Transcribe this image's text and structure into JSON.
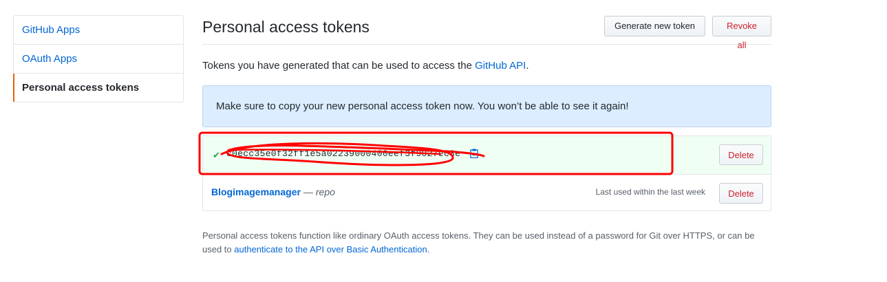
{
  "sidebar": {
    "items": [
      {
        "label": "GitHub Apps"
      },
      {
        "label": "OAuth Apps"
      },
      {
        "label": "Personal access tokens"
      }
    ]
  },
  "header": {
    "title": "Personal access tokens",
    "generate_label": "Generate new token",
    "revoke_label": "Revoke all"
  },
  "intro": {
    "text": "Tokens you have generated that can be used to access the ",
    "link": "GitHub API",
    "suffix": "."
  },
  "flash": {
    "message": "Make sure to copy your new personal access token now. You won’t be able to see it again!"
  },
  "tokens": [
    {
      "value": "c0ecc35e0f32ff1e5a02239000400eef3f9027ec3e",
      "delete_label": "Delete"
    },
    {
      "name": "Blogimagemanager",
      "dash": " — ",
      "scope": "repo",
      "last_used": "Last used within the last week",
      "delete_label": "Delete"
    }
  ],
  "footnote": {
    "text": "Personal access tokens function like ordinary OAuth access tokens. They can be used instead of a password for Git over HTTPS, or can be used to ",
    "link": "authenticate to the API over Basic Authentication",
    "suffix": "."
  },
  "colors": {
    "link": "#0366d6",
    "danger": "#cb2431",
    "flash_bg": "#dbedff",
    "new_token_bg": "#f0fff4",
    "annotation": "#ff0000"
  }
}
